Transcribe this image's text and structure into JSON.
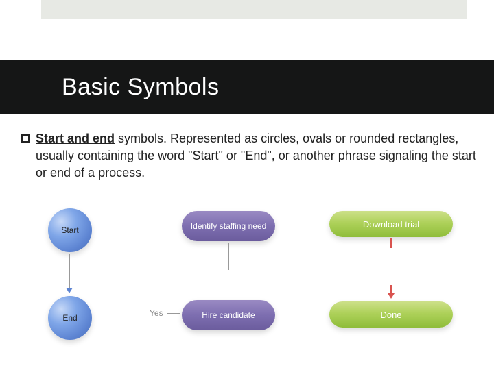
{
  "title": "Basic Symbols",
  "bullet": {
    "lead": "Start and end",
    "rest": " symbols. Represented as circles, ovals or rounded rectangles, usually containing the word \"Start\" or \"End\", or another phrase signaling the start or end of a process."
  },
  "shapes": {
    "circ_start": "Start",
    "circ_end": "End",
    "purple_top": "Identify staffing need",
    "purple_bottom": "Hire candidate",
    "green_top": "Download trial",
    "green_bottom": "Done",
    "yes_label": "Yes"
  }
}
